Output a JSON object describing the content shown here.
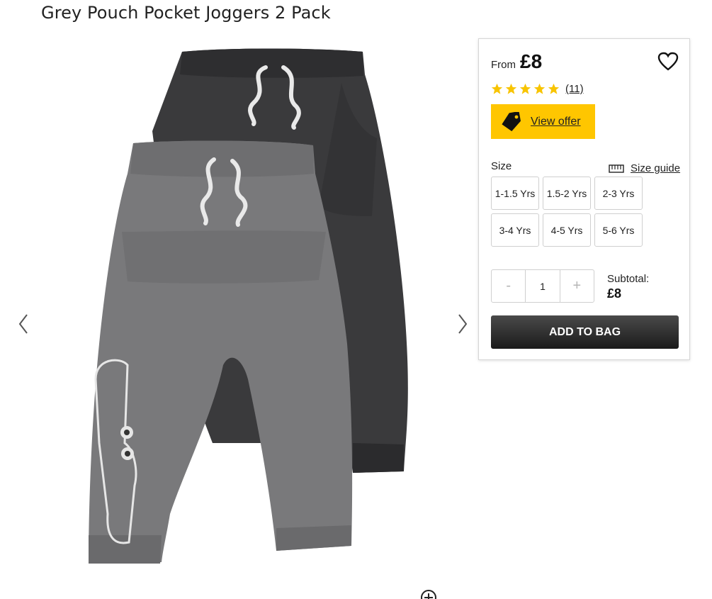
{
  "product": {
    "title": "Grey Pouch Pocket Joggers 2 Pack"
  },
  "price": {
    "prefix": "From",
    "value": "£8"
  },
  "rating": {
    "stars": 5,
    "count": "(11)",
    "star_color": "#f8c400"
  },
  "offer": {
    "label": "View offer",
    "bg_color": "#ffc600",
    "icon": "price-tag-icon"
  },
  "size": {
    "label": "Size",
    "guide_label": "Size guide",
    "guide_icon": "ruler-icon",
    "options": [
      "1-1.5 Yrs",
      "1.5-2 Yrs",
      "2-3 Yrs",
      "3-4 Yrs",
      "4-5 Yrs",
      "5-6 Yrs"
    ]
  },
  "quantity": {
    "minus": "-",
    "value": "1",
    "plus": "+"
  },
  "subtotal": {
    "label": "Subtotal:",
    "value": "£8"
  },
  "cart": {
    "add_label": "ADD TO BAG"
  },
  "gallery": {
    "prev_icon": "chevron-left-icon",
    "next_icon": "chevron-right-icon",
    "zoom_icon": "zoom-plus-icon",
    "image": "grey-and-charcoal-joggers"
  }
}
